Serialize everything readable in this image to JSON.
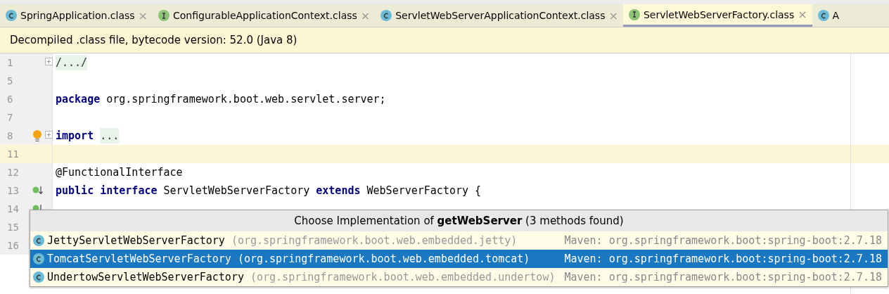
{
  "tabs": [
    {
      "label": "SpringApplication.class",
      "kind": "class",
      "close": "×",
      "selected": false
    },
    {
      "label": "ConfigurableApplicationContext.class",
      "kind": "interface",
      "close": "×",
      "selected": false
    },
    {
      "label": "ServletWebServerApplicationContext.class",
      "kind": "class",
      "close": "×",
      "selected": false
    },
    {
      "label": "ServletWebServerFactory.class",
      "kind": "interface",
      "close": "×",
      "selected": true
    },
    {
      "label": "A",
      "kind": "class",
      "selected": false
    }
  ],
  "banner": "Decompiled .class file, bytecode version: 52.0 (Java 8)",
  "lines": [
    {
      "number": "1",
      "current": false,
      "fold": true,
      "kind": "plain",
      "tokens": [
        {
          "kind": "folded",
          "text": "/.../"
        }
      ]
    },
    {
      "number": "5",
      "current": false,
      "fold": false,
      "kind": "plain"
    },
    {
      "number": "6",
      "current": false,
      "fold": false,
      "kind": "plain",
      "tokens": [
        {
          "kind": "keyword",
          "text": "package"
        },
        {
          "kind": "plain",
          "text": " org.springframework.boot.web.servlet.server;"
        }
      ]
    },
    {
      "number": "7",
      "current": false,
      "fold": false,
      "kind": "plain"
    },
    {
      "number": "8",
      "current": false,
      "fold": true,
      "kind": "bulb",
      "tokens": [
        {
          "kind": "keyword",
          "text": "import "
        },
        {
          "kind": "folded",
          "text": "..."
        }
      ]
    },
    {
      "number": "11",
      "current": true,
      "fold": false,
      "kind": "plain"
    },
    {
      "number": "12",
      "current": false,
      "fold": false,
      "kind": "plain",
      "tokens": [
        {
          "kind": "plain",
          "text": "@FunctionalInterface"
        }
      ]
    },
    {
      "number": "13",
      "current": false,
      "fold": false,
      "kind": "implemented",
      "tokens": [
        {
          "kind": "keyword",
          "text": "public interface"
        },
        {
          "kind": "plain",
          "text": " ServletWebServerFactory "
        },
        {
          "kind": "keyword",
          "text": "extends"
        },
        {
          "kind": "plain",
          "text": " WebServerFactory {"
        }
      ]
    },
    {
      "number": "14",
      "current": false,
      "fold": false,
      "kind": "implemented"
    },
    {
      "number": "15",
      "current": false,
      "fold": false,
      "kind": "plain"
    },
    {
      "number": "16",
      "current": false,
      "fold": false,
      "kind": "plain"
    }
  ],
  "popup": {
    "title": "Choose Implementation of **getWebServer** (3 methods found)",
    "items": [
      {
        "name": "JettyServletWebServerFactory",
        "package": "(org.springframework.boot.web.embedded.jetty)",
        "module": "Maven: org.springframework.boot:spring-boot:2.7.18",
        "selected": false
      },
      {
        "name": "TomcatServletWebServerFactory",
        "package": "(org.springframework.boot.web.embedded.tomcat)",
        "module": "Maven: org.springframework.boot:spring-boot:2.7.18",
        "selected": true
      },
      {
        "name": "UndertowServletWebServerFactory",
        "package": "(org.springframework.boot.web.embedded.undertow)",
        "module": "Maven: org.springframework.boot:spring-boot:2.7.18",
        "selected": false
      }
    ]
  }
}
